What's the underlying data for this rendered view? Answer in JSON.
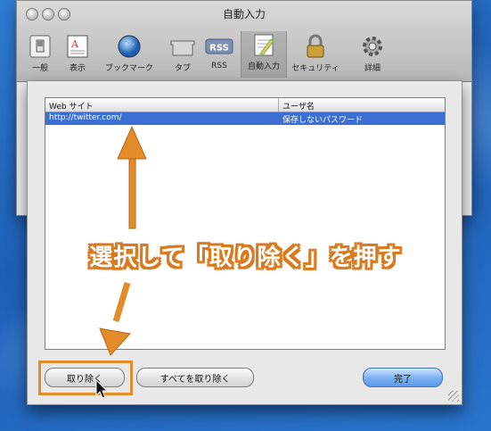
{
  "window": {
    "title": "自動入力"
  },
  "toolbar": {
    "items": [
      {
        "label": "一般",
        "icon": "switch-icon"
      },
      {
        "label": "表示",
        "icon": "appearance-icon"
      },
      {
        "label": "ブックマーク",
        "icon": "globe-icon"
      },
      {
        "label": "タブ",
        "icon": "tabs-icon"
      },
      {
        "label": "RSS",
        "icon": "rss-icon"
      },
      {
        "label": "自動入力",
        "icon": "autofill-pencil-icon"
      },
      {
        "label": "セキュリティ",
        "icon": "lock-icon"
      },
      {
        "label": "詳細",
        "icon": "gear-icon"
      }
    ],
    "rss_text": "RSS",
    "selected": "自動入力"
  },
  "table": {
    "columns": [
      "Web サイト",
      "ユーザ名"
    ],
    "rows": [
      {
        "site": "http://twitter.com/",
        "user": "保存しないパスワード",
        "selected": true
      }
    ]
  },
  "buttons": {
    "remove": "取り除く",
    "remove_all": "すべてを取り除く",
    "done": "完了"
  },
  "annotation": {
    "text": "選択して「取り除く」を押す",
    "color": "#e38b2b"
  },
  "colors": {
    "selection": "#3b6fd3",
    "desktop": "#2a6cc4"
  }
}
